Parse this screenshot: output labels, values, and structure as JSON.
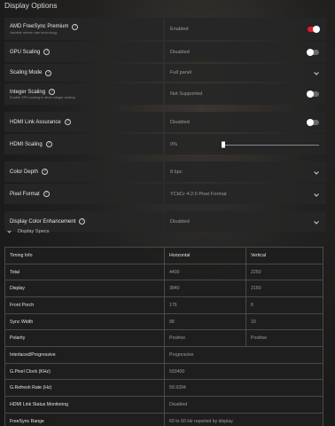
{
  "page_title": "Display Options",
  "settings": {
    "freesync": {
      "label": "AMD FreeSync Premium",
      "sub": "Variable refresh rate technology",
      "value": "Enabled",
      "toggle": "on"
    },
    "gpu_scaling": {
      "label": "GPU Scaling",
      "value": "Disabled",
      "toggle": "off"
    },
    "scaling_mode": {
      "label": "Scaling Mode",
      "value": "Full panel"
    },
    "integer_scaling": {
      "label": "Integer Scaling",
      "sub": "Enable GPU scaling to allow integer scaling.",
      "value": "Not Supported",
      "toggle": "off"
    },
    "hdmi_link": {
      "label": "HDMI Link Assurance",
      "value": "Disabled",
      "toggle": "off"
    },
    "hdmi_scaling": {
      "label": "HDMI Scaling",
      "value": "0%"
    },
    "color_depth": {
      "label": "Color Depth",
      "value": "8 bpc"
    },
    "pixel_format": {
      "label": "Pixel Format",
      "value": "YCbCr 4:2:0 Pixel Format"
    },
    "color_enh": {
      "label": "Display Color Enhancement",
      "value": "Disabled"
    }
  },
  "display_specs": {
    "title": "Display Specs",
    "timing_headers": [
      "Timing Info",
      "Horizontal",
      "Vertical"
    ],
    "timing_rows": [
      [
        "Total",
        "4400",
        "2250"
      ],
      [
        "Display",
        "3840",
        "2160"
      ],
      [
        "Front Porch",
        "176",
        "8"
      ],
      [
        "Sync Width",
        "88",
        "10"
      ],
      [
        "Polarity",
        "Positive",
        "Positive"
      ]
    ],
    "other_rows": [
      [
        "Interlaced/Progressive",
        "Progressive"
      ],
      [
        "G.Pixel Clock (KHz)",
        "593400"
      ],
      [
        "G.Refresh Rate (Hz)",
        "59.9394"
      ],
      [
        "HDMI Link Status Monitoring",
        "Disabled"
      ],
      [
        "FreeSync Range",
        "60 to 60 Hz reported by display"
      ]
    ]
  },
  "colors": {
    "accent": "#e01c2b"
  }
}
